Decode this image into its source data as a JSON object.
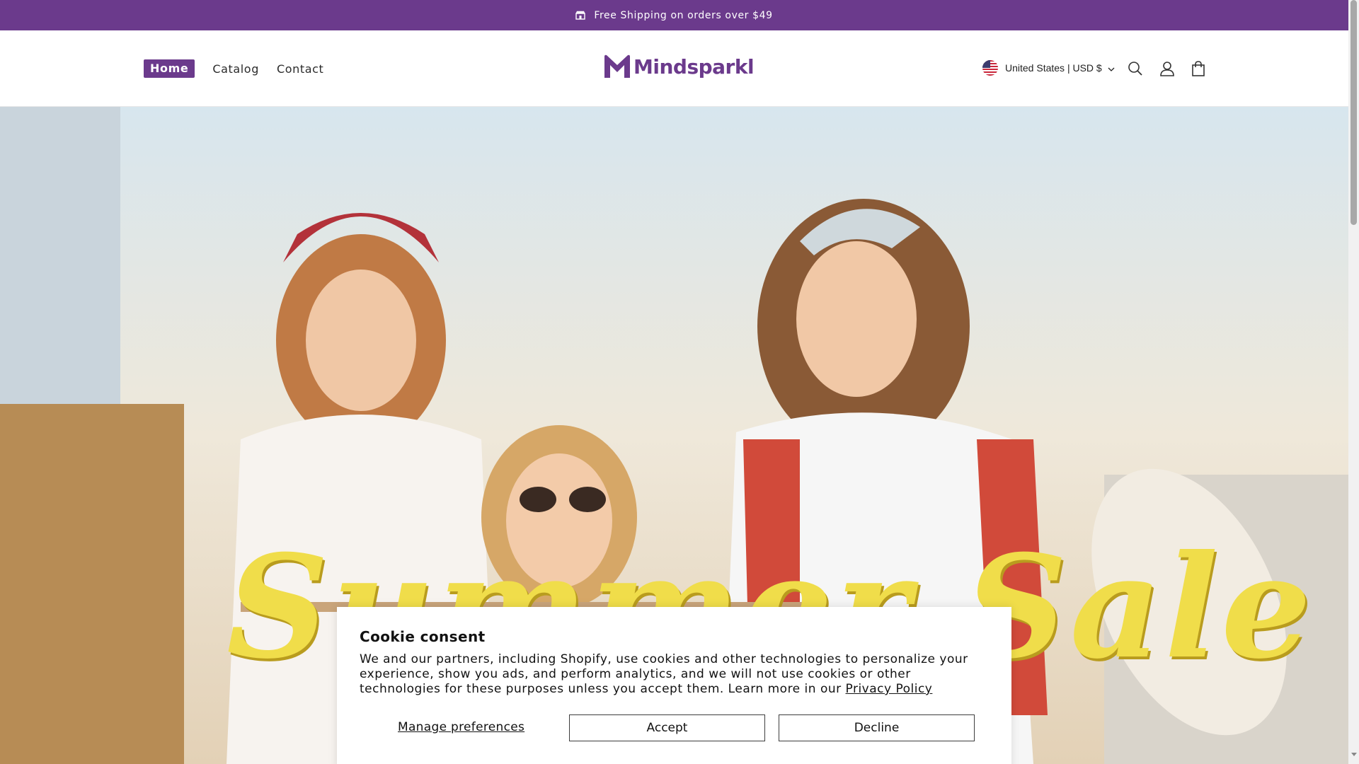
{
  "announcement": {
    "text": "Free Shipping on orders over $49",
    "icon": "store-icon"
  },
  "nav": {
    "items": [
      {
        "label": "Home",
        "active": true
      },
      {
        "label": "Catalog",
        "active": false
      },
      {
        "label": "Contact",
        "active": false
      }
    ]
  },
  "logo": {
    "text": "Mindsparkl"
  },
  "locale": {
    "label": "United States | USD $",
    "flag": "us-flag-icon"
  },
  "header_icons": [
    "search-icon",
    "account-icon",
    "cart-icon"
  ],
  "hero": {
    "banner_text": "Summer Sale"
  },
  "cookie": {
    "title": "Cookie consent",
    "body": "We and our partners, including Shopify, use cookies and other technologies to personalize your experience, show you ads, and perform analytics, and we will not use cookies or other technologies for these purposes unless you accept them. Learn more in our ",
    "privacy_link": "Privacy Policy",
    "manage_label": "Manage preferences",
    "accept_label": "Accept",
    "decline_label": "Decline"
  },
  "colors": {
    "brand": "#6b3a8c",
    "sale_yellow": "#f0dd4a"
  }
}
